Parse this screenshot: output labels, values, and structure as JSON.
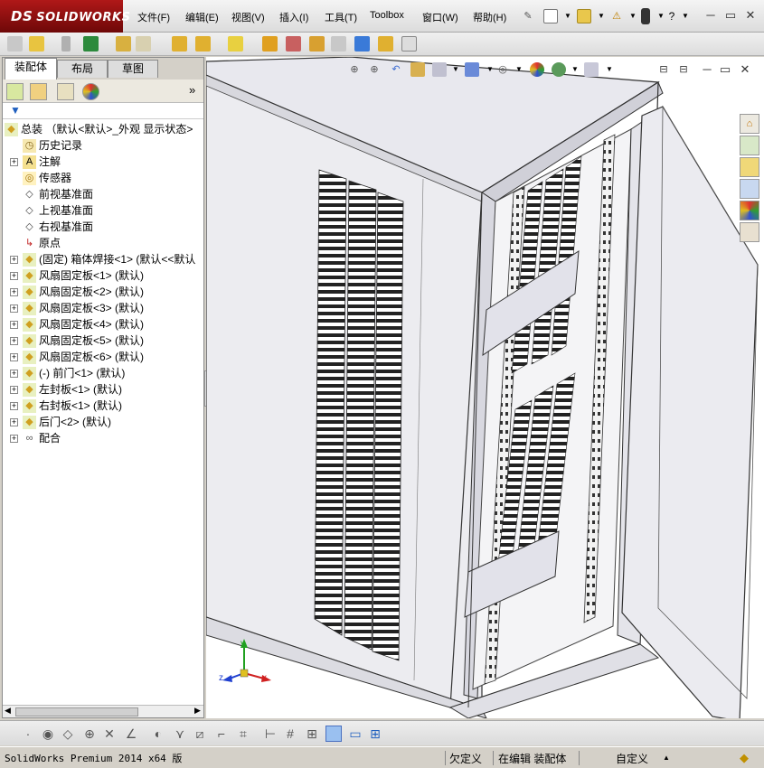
{
  "app": {
    "logo_prefix": "DS",
    "logo_text": "SOLIDWORKS"
  },
  "menu": {
    "file": "文件(F)",
    "edit": "编辑(E)",
    "view": "视图(V)",
    "insert": "插入(I)",
    "tools": "工具(T)",
    "toolbox": "Toolbox",
    "window": "窗口(W)",
    "help": "帮助(H)"
  },
  "tabs": {
    "assembly": "装配体",
    "layout": "布局",
    "sketch": "草图"
  },
  "tree": {
    "root": "总装 （默认<默认>_外观 显示状态>",
    "items": [
      {
        "label": "历史记录",
        "icon": "history-icon",
        "expandable": false
      },
      {
        "label": "注解",
        "icon": "annotation-icon",
        "expandable": true
      },
      {
        "label": "传感器",
        "icon": "sensor-icon",
        "expandable": false
      },
      {
        "label": "前视基准面",
        "icon": "plane-icon",
        "expandable": false
      },
      {
        "label": "上视基准面",
        "icon": "plane-icon",
        "expandable": false
      },
      {
        "label": "右视基准面",
        "icon": "plane-icon",
        "expandable": false
      },
      {
        "label": "原点",
        "icon": "origin-icon",
        "expandable": false
      },
      {
        "label": "(固定) 箱体焊接<1> (默认<<默认",
        "icon": "part-icon",
        "expandable": true
      },
      {
        "label": "风扇固定板<1> (默认)",
        "icon": "part-icon",
        "expandable": true
      },
      {
        "label": "风扇固定板<2> (默认)",
        "icon": "part-icon",
        "expandable": true
      },
      {
        "label": "风扇固定板<3> (默认)",
        "icon": "part-icon",
        "expandable": true
      },
      {
        "label": "风扇固定板<4> (默认)",
        "icon": "part-icon",
        "expandable": true
      },
      {
        "label": "风扇固定板<5> (默认)",
        "icon": "part-icon",
        "expandable": true
      },
      {
        "label": "风扇固定板<6> (默认)",
        "icon": "part-icon",
        "expandable": true
      },
      {
        "label": "(-) 前门<1> (默认)",
        "icon": "part-icon",
        "expandable": true
      },
      {
        "label": "左封板<1> (默认)",
        "icon": "part-icon",
        "expandable": true
      },
      {
        "label": "右封板<1> (默认)",
        "icon": "part-icon",
        "expandable": true
      },
      {
        "label": "后门<2> (默认)",
        "icon": "part-icon",
        "expandable": true
      },
      {
        "label": "配合",
        "icon": "mates-icon",
        "expandable": true
      }
    ]
  },
  "triad": {
    "x": "x",
    "y": "y",
    "z": "z"
  },
  "status": {
    "product": "SolidWorks Premium 2014 x64 版",
    "underdefined": "欠定义",
    "editing": "在编辑 装配体",
    "units": "自定义",
    "units_arrow": "▲"
  },
  "colors": {
    "logo_red": "#9c1010",
    "accent_blue": "#1f5fbf",
    "model_grey": "#e8e8ec"
  }
}
